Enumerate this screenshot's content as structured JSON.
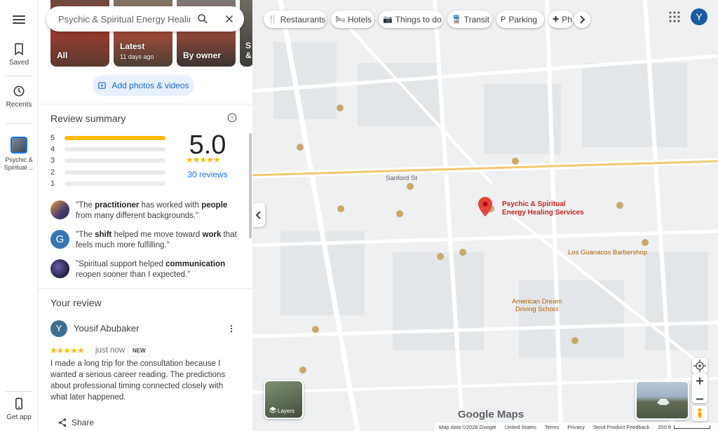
{
  "rail": {
    "saved": "Saved",
    "recents": "Recents",
    "recent_place": "Psychic & Spiritual ...",
    "get_app": "Get app"
  },
  "search": {
    "value": "Psychic & Spiritual Energy Healing S"
  },
  "photos": {
    "all": "All",
    "latest": "Latest",
    "latest_sub": "11 days ago",
    "by_owner": "By owner",
    "fourth": "S &"
  },
  "add_photos": "Add photos & videos",
  "review_summary": {
    "title": "Review summary",
    "rating": "5.0",
    "stars": "★★★★★",
    "reviews_link": "30 reviews",
    "bars": [
      {
        "n": "5",
        "fill": 1.0
      },
      {
        "n": "4",
        "fill": 0.0
      },
      {
        "n": "3",
        "fill": 0.0
      },
      {
        "n": "2",
        "fill": 0.0
      },
      {
        "n": "1",
        "fill": 0.0
      }
    ]
  },
  "snippets": [
    {
      "pre": "\"The ",
      "k1": "practitioner",
      "mid": " has worked with ",
      "k2": "people",
      "post": " from many different backgrounds.\""
    },
    {
      "pre": "\"The ",
      "k1": "shift",
      "mid": " helped me move toward ",
      "k2": "work",
      "post": " that feels much more fulfilling.\""
    },
    {
      "pre": "\"Spiritual support helped ",
      "k1": "communication",
      "mid": "",
      "k2": "",
      "post": " reopen sooner than I expected.\""
    }
  ],
  "snippet_avatars": [
    "",
    "G",
    ""
  ],
  "your_review": {
    "title": "Your review",
    "avatar_letter": "Y",
    "user_name": "Yousif Abubaker",
    "stars": "★★★★★",
    "time": "just now",
    "badge": "NEW",
    "body": "I made a long trip for the consultation because I wanted a serious career reading. The predictions about professional timing connected closely with what later happened.",
    "share": "Share"
  },
  "chips": [
    {
      "label": "Restaurants",
      "icon": "restaurant-icon"
    },
    {
      "label": "Hotels",
      "icon": "hotel-icon"
    },
    {
      "label": "Things to do",
      "icon": "camera-icon"
    },
    {
      "label": "Transit",
      "icon": "transit-icon"
    },
    {
      "label": "Parking",
      "icon": "parking-icon"
    },
    {
      "label": "Ph",
      "icon": "pharmacy-icon"
    }
  ],
  "account_letter": "Y",
  "layers_label": "Layers",
  "map": {
    "place_label_1": "Psychic & Spiritual",
    "place_label_2": "Energy Healing Services",
    "labels": {
      "sanford": "Sanford St",
      "los_guanacos": "Los Guanacos Barbershop",
      "american_dream_1": "American Dream",
      "american_dream_2": "Driving School"
    },
    "logo": "Google Maps"
  },
  "footer": {
    "map_data": "Map data ©2026 Google",
    "country": "United States",
    "terms": "Terms",
    "privacy": "Privacy",
    "feedback": "Send Product Feedback",
    "scale": "200 ft"
  }
}
